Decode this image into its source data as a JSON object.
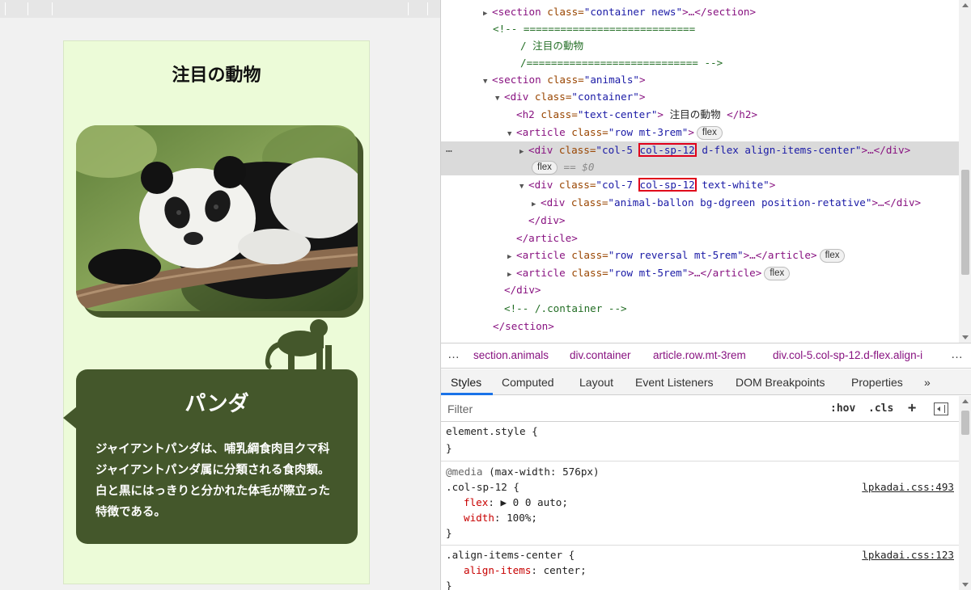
{
  "preview": {
    "section_title": "注目の動物",
    "animal_name": "パンダ",
    "animal_description": "ジャイアントパンダは、哺乳綱食肉目クマ科ジャイアントパンダ属に分類される食肉類。白と黒にはっきりと分かれた体毛が際立った特徴である。",
    "photo_alt": "panda-photo",
    "colors": {
      "card_bg": "#ecfbd8",
      "dark_green": "#44572b"
    }
  },
  "dom": {
    "l1_open": "<section",
    "l1_attr": " class=",
    "l1_val": "\"container news\"",
    "l1_close": ">…</section>",
    "l2": "<!-- ============================",
    "l3": "/  注目の動物",
    "l4": "/============================ -->",
    "l5_open": "<section",
    "l5_attr": " class=",
    "l5_val": "\"animals\"",
    "l5_close": ">",
    "l6_open": "<div",
    "l6_attr": " class=",
    "l6_val": "\"container\"",
    "l6_close": ">",
    "l7_open": "<h2",
    "l7_attr": " class=",
    "l7_val": "\"text-center\"",
    "l7_close": ">",
    "l7_text": " 注目の動物 ",
    "l7_end": "</h2>",
    "l8_open": "<article",
    "l8_attr": " class=",
    "l8_val": "\"row mt-3rem\"",
    "l8_close": ">",
    "l8_badge": "flex",
    "l9_open": "<div",
    "l9_attr": " class=",
    "l9_val_a": "\"col-5",
    "l9_val_hl": "col-sp-12",
    "l9_val_b": "d-flex align-items-center\"",
    "l9_close": ">…</div>",
    "l9_badge": "flex",
    "l9_dollar": "== $0",
    "l10_open": "<div",
    "l10_attr": " class=",
    "l10_val_a": "\"col-7",
    "l10_val_hl": "col-sp-12",
    "l10_val_b": "text-white\"",
    "l10_close": ">",
    "l11_open": "<div",
    "l11_attr": " class=",
    "l11_val": "\"animal-ballon bg-dgreen position-retative\"",
    "l11_close": ">…</div>",
    "l12": "</div>",
    "l13": "</article>",
    "l14_open": "<article",
    "l14_attr": " class=",
    "l14_val": "\"row reversal mt-5rem\"",
    "l14_close": ">…</article>",
    "l14_badge": "flex",
    "l15_open": "<article",
    "l15_attr": " class=",
    "l15_val": "\"row mt-5rem\"",
    "l15_close": ">…</article>",
    "l15_badge": "flex",
    "l16": "</div>",
    "l17": "<!-- /.container -->",
    "l18": "</section>",
    "dots": "…"
  },
  "breadcrumbs": {
    "more_left": "…",
    "items": [
      "section.animals",
      "div.container",
      "article.row.mt-3rem",
      "div.col-5.col-sp-12.d-flex.align-i"
    ],
    "more_right": "…"
  },
  "tabs": [
    "Styles",
    "Computed",
    "Layout",
    "Event Listeners",
    "DOM Breakpoints",
    "Properties",
    "»"
  ],
  "filter": {
    "placeholder": "Filter",
    "hov": ":hov",
    "cls": ".cls",
    "plus": "+"
  },
  "styles": {
    "r1_sel": "element.style {",
    "r1_end": "}",
    "r2_media_kw": "@media",
    "r2_media_q": " (max-width: 576px)",
    "r2_sel": ".col-sp-12 {",
    "r2_src": "lpkadai.css:493",
    "r2_p1": "flex",
    "r2_v1": ": ▶ 0 0 auto;",
    "r2_p2": "width",
    "r2_v2": ": 100%;",
    "r2_end": "}",
    "r3_sel": ".align-items-center {",
    "r3_src": "lpkadai.css:123",
    "r3_p1": "align-items",
    "r3_v1": ": center;",
    "r3_end": "}"
  }
}
